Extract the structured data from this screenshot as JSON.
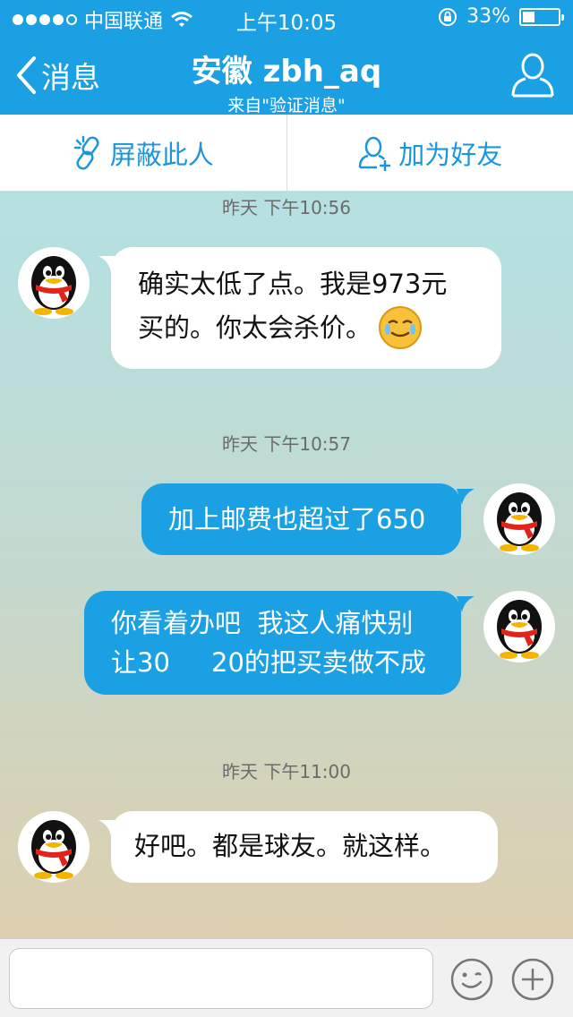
{
  "status_bar": {
    "carrier": "中国联通",
    "time": "上午10:05",
    "battery": "33%",
    "battery_level": 0.33,
    "signal_dots_filled": 4,
    "signal_dots_total": 5
  },
  "header": {
    "back_label": "消息",
    "title": "安徽 zbh_aq",
    "subtitle": "来自\"验证消息\""
  },
  "actions": {
    "block_label": "屏蔽此人",
    "add_friend_label": "加为好友"
  },
  "messages": [
    {
      "timestamp": "昨天  下午10:56"
    },
    {
      "side": "in",
      "lines": [
        "确实太低了点。我是973元",
        "买的。你太会杀价。"
      ],
      "has_emoji": true
    },
    {
      "timestamp": "昨天  下午10:57"
    },
    {
      "side": "out",
      "lines": [
        "加上邮费也超过了650"
      ]
    },
    {
      "side": "out",
      "lines": [
        "你看着办吧  我这人痛快别",
        "让30     20的把买卖做不成"
      ]
    },
    {
      "timestamp": "昨天  下午11:00"
    },
    {
      "side": "in",
      "lines": [
        "好吧。都是球友。就这样。"
      ]
    }
  ],
  "input": {
    "placeholder": ""
  },
  "colors": {
    "accent": "#1aa0e3",
    "bubble_in": "#ffffff",
    "header": "#1aa0e3"
  },
  "icons": [
    "back-chevron-icon",
    "profile-icon",
    "link-block-icon",
    "add-friend-icon",
    "emoji-icon",
    "plus-icon",
    "wifi-icon",
    "lock-rotation-icon",
    "battery-icon"
  ]
}
